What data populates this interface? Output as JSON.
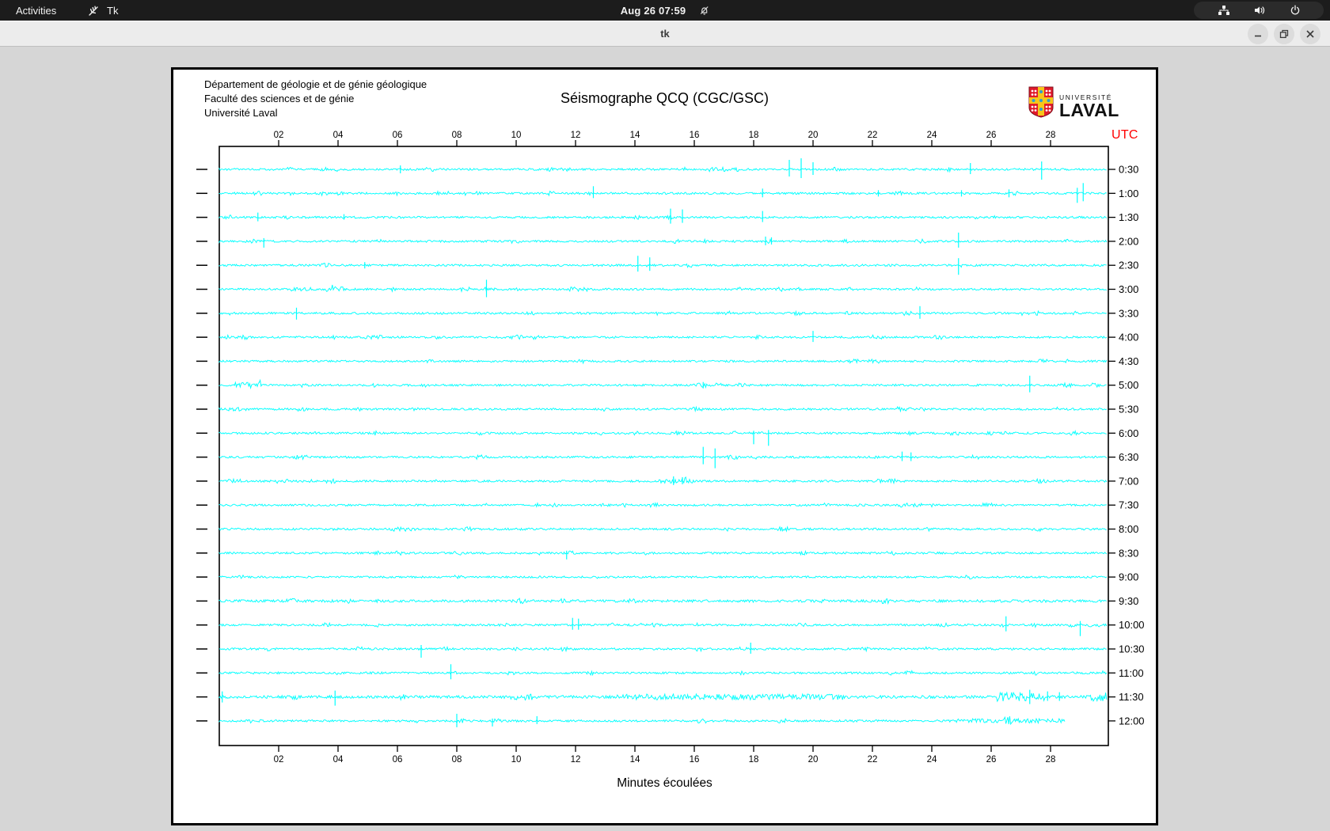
{
  "topbar": {
    "activities_label": "Activities",
    "app_name": "Tk",
    "clock": "Aug 26  07:59",
    "icons": [
      "tk-feather-icon",
      "bell-muted-icon",
      "network-icon",
      "volume-icon",
      "power-icon"
    ]
  },
  "titlebar": {
    "title": "tk",
    "icons": [
      "minimize-icon",
      "maximize-icon",
      "close-icon"
    ]
  },
  "logo": {
    "wordmark_top": "UNIVERSITÉ",
    "wordmark_bottom": "LAVAL",
    "shield_red": "#e01a2b",
    "shield_gold": "#f6c61a",
    "shield_blue": "#2f9fd0"
  },
  "chart_data": {
    "type": "line",
    "subtype": "seismogram-helicorder",
    "title": "Séismographe QCQ (CGC/GSC)",
    "header_lines": [
      "Département de géologie et de génie géologique",
      "Faculté des sciences et de génie",
      "Université Laval"
    ],
    "xlabel": "Minutes écoulées",
    "time_zone_label": "UTC",
    "time_zone_color": "#ff0000",
    "trace_color": "#00ffff",
    "axis_color": "#000000",
    "x_range_minutes": [
      0,
      30
    ],
    "x_ticks": [
      "02",
      "04",
      "06",
      "08",
      "10",
      "12",
      "14",
      "16",
      "18",
      "20",
      "22",
      "24",
      "26",
      "28"
    ],
    "rows": [
      {
        "label": "0:30",
        "noise": 1,
        "end": 30,
        "segments": [],
        "spikes": [
          [
            6.1,
            5,
            5
          ],
          [
            19.2,
            12,
            9
          ],
          [
            19.6,
            14,
            11
          ],
          [
            20.0,
            9,
            7
          ],
          [
            25.3,
            8,
            6
          ],
          [
            27.7,
            10,
            13
          ]
        ]
      },
      {
        "label": "1:00",
        "noise": 1,
        "end": 30,
        "segments": [],
        "spikes": [
          [
            12.6,
            9,
            6
          ],
          [
            18.3,
            6,
            5
          ],
          [
            22.2,
            4,
            4
          ],
          [
            25.0,
            4,
            4
          ],
          [
            26.6,
            5,
            5
          ],
          [
            28.9,
            7,
            12
          ],
          [
            29.1,
            13,
            10
          ]
        ]
      },
      {
        "label": "1:30",
        "noise": 1,
        "end": 30,
        "segments": [],
        "spikes": [
          [
            1.3,
            6,
            5
          ],
          [
            4.2,
            4,
            3
          ],
          [
            15.2,
            11,
            8
          ],
          [
            15.6,
            10,
            7
          ],
          [
            18.3,
            8,
            6
          ]
        ]
      },
      {
        "label": "2:00",
        "noise": 1,
        "end": 30,
        "segments": [],
        "spikes": [
          [
            1.5,
            4,
            8
          ],
          [
            18.4,
            6,
            5
          ],
          [
            18.6,
            5,
            4
          ],
          [
            24.9,
            11,
            8
          ]
        ]
      },
      {
        "label": "2:30",
        "noise": 1,
        "end": 30,
        "segments": [],
        "spikes": [
          [
            4.9,
            4,
            4
          ],
          [
            14.1,
            12,
            8
          ],
          [
            14.5,
            10,
            7
          ],
          [
            24.9,
            9,
            12
          ]
        ]
      },
      {
        "label": "3:00",
        "noise": 1,
        "end": 30,
        "segments": [
          [
            3.6,
            4.2,
            2.5
          ]
        ],
        "spikes": [
          [
            9.0,
            12,
            10
          ]
        ]
      },
      {
        "label": "3:30",
        "noise": 1,
        "end": 30,
        "segments": [],
        "spikes": [
          [
            2.6,
            7,
            8
          ],
          [
            23.6,
            9,
            7
          ]
        ]
      },
      {
        "label": "4:00",
        "noise": 1,
        "end": 30,
        "segments": [],
        "spikes": [
          [
            20.0,
            8,
            6
          ]
        ]
      },
      {
        "label": "4:30",
        "noise": 0.95,
        "end": 30,
        "segments": [],
        "spikes": []
      },
      {
        "label": "5:00",
        "noise": 1,
        "end": 30,
        "segments": [
          [
            0.5,
            1.4,
            2.8
          ]
        ],
        "spikes": [
          [
            16.3,
            4,
            4
          ],
          [
            27.3,
            12,
            9
          ]
        ]
      },
      {
        "label": "5:30",
        "noise": 1,
        "end": 30,
        "segments": [
          [
            0.2,
            0.9,
            2.0
          ],
          [
            22.8,
            23.3,
            2.4
          ]
        ],
        "spikes": []
      },
      {
        "label": "6:00",
        "noise": 1,
        "end": 30,
        "segments": [],
        "spikes": [
          [
            18.0,
            3,
            14
          ],
          [
            18.5,
            4,
            16
          ]
        ]
      },
      {
        "label": "6:30",
        "noise": 1,
        "end": 30,
        "segments": [],
        "spikes": [
          [
            16.3,
            13,
            9
          ],
          [
            16.7,
            11,
            14
          ],
          [
            23.0,
            7,
            5
          ],
          [
            23.3,
            6,
            5
          ]
        ]
      },
      {
        "label": "7:00",
        "noise": 1,
        "end": 30,
        "segments": [
          [
            14.8,
            16.0,
            1.9
          ]
        ],
        "spikes": [
          [
            15.3,
            6,
            5
          ],
          [
            15.6,
            5,
            4
          ]
        ]
      },
      {
        "label": "7:30",
        "noise": 0.95,
        "end": 30,
        "segments": [],
        "spikes": []
      },
      {
        "label": "8:00",
        "noise": 1,
        "end": 30,
        "segments": [
          [
            18.8,
            19.3,
            2.6
          ]
        ],
        "spikes": []
      },
      {
        "label": "8:30",
        "noise": 1,
        "end": 30,
        "segments": [],
        "spikes": [
          [
            11.7,
            3,
            8
          ]
        ]
      },
      {
        "label": "9:00",
        "noise": 0.95,
        "end": 30,
        "segments": [],
        "spikes": []
      },
      {
        "label": "9:30",
        "noise": 1.25,
        "end": 30,
        "segments": [],
        "spikes": []
      },
      {
        "label": "10:00",
        "noise": 1,
        "end": 30,
        "segments": [],
        "spikes": [
          [
            11.9,
            9,
            6
          ],
          [
            12.1,
            8,
            6
          ],
          [
            26.5,
            11,
            8
          ],
          [
            29.0,
            5,
            14
          ]
        ]
      },
      {
        "label": "10:30",
        "noise": 1,
        "end": 30,
        "segments": [],
        "spikes": [
          [
            6.8,
            5,
            11
          ],
          [
            17.9,
            8,
            6
          ]
        ]
      },
      {
        "label": "11:00",
        "noise": 1,
        "end": 30,
        "segments": [],
        "spikes": [
          [
            7.8,
            11,
            8
          ]
        ]
      },
      {
        "label": "11:30",
        "noise": 1.4,
        "end": 30,
        "segments": [
          [
            13.4,
            21.0,
            2.0
          ],
          [
            26.2,
            27.8,
            3.2
          ],
          [
            29.3,
            30.0,
            3.2
          ]
        ],
        "spikes": [
          [
            0.1,
            7,
            7
          ],
          [
            3.9,
            8,
            11
          ],
          [
            27.3,
            9,
            9
          ],
          [
            27.9,
            7,
            5
          ],
          [
            28.3,
            6,
            5
          ]
        ]
      },
      {
        "label": "12:00",
        "noise": 1,
        "end": 28.5,
        "segments": [
          [
            24.8,
            28.5,
            2.2
          ]
        ],
        "spikes": [
          [
            8.0,
            9,
            8
          ],
          [
            9.2,
            3,
            7
          ],
          [
            10.7,
            6,
            4
          ]
        ]
      }
    ]
  }
}
